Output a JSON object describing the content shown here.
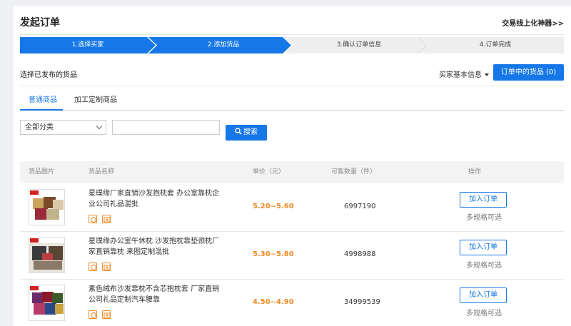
{
  "header": {
    "title": "发起订单",
    "link": "交易线上化神器>>"
  },
  "steps": [
    {
      "label": "1.选择买家",
      "active": true
    },
    {
      "label": "2.添加货品",
      "active": true
    },
    {
      "label": "3.确认订单信息",
      "active": false
    },
    {
      "label": "4.订单完成",
      "active": false
    }
  ],
  "toolbar": {
    "section_title": "选择已发布的货品",
    "buyer_info": "买家基本信息",
    "order_goods_button": "订单中的货品 (0)"
  },
  "tabs": [
    {
      "label": "普通商品",
      "active": true
    },
    {
      "label": "加工定制商品",
      "active": false
    }
  ],
  "filter": {
    "category_selected": "全部分类",
    "search_value": "",
    "search_button": "搜索"
  },
  "table": {
    "headers": [
      "货品图片",
      "货品名称",
      "单价（元）",
      "可售数量（件）",
      "操作"
    ],
    "rows": [
      {
        "name": "星璞缘厂家直销沙发抱枕套 办公室靠枕企业公司礼品混批",
        "price": "5.20~5.60",
        "qty": "6997190",
        "action": "加入订单",
        "note": "多规格可选"
      },
      {
        "name": "星璞缘办公室午休枕 沙发抱枕靠垫颈枕厂家直销靠枕 来图定制混批",
        "price": "5.30~5.80",
        "qty": "4998988",
        "action": "加入订单",
        "note": "多规格可选"
      },
      {
        "name": "素色绒布沙发靠枕不含芯抱枕套 厂家直销公司礼品定制汽车腰靠",
        "price": "4.50~4.90",
        "qty": "34999539",
        "action": "加入订单",
        "note": "多规格可选"
      }
    ]
  },
  "colors": {
    "accent": "#1677e8",
    "price": "#f08a24"
  }
}
